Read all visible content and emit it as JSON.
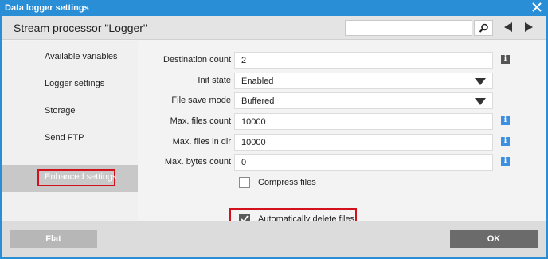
{
  "window": {
    "title": "Data logger settings"
  },
  "header": {
    "title": "Stream processor \"Logger\"",
    "search_value": ""
  },
  "sidebar": {
    "items": [
      {
        "label": "Available variables"
      },
      {
        "label": "Logger settings"
      },
      {
        "label": "Storage"
      },
      {
        "label": "Send FTP"
      },
      {
        "label": "Enhanced settings",
        "active": true
      }
    ]
  },
  "form": {
    "destination_count": {
      "label": "Destination count",
      "value": "2"
    },
    "init_state": {
      "label": "Init state",
      "value": "Enabled"
    },
    "file_save_mode": {
      "label": "File save mode",
      "value": "Buffered"
    },
    "max_files_count": {
      "label": "Max. files count",
      "value": "10000"
    },
    "max_files_in_dir": {
      "label": "Max. files in dir",
      "value": "10000"
    },
    "max_bytes_count": {
      "label": "Max. bytes count",
      "value": "0"
    },
    "compress_files": {
      "label": "Compress files",
      "checked": false
    },
    "auto_delete": {
      "label": "Automatically delete files",
      "checked": true
    },
    "info_glyph": "i"
  },
  "footer": {
    "flat_label": "Flat",
    "ok_label": "OK"
  },
  "colors": {
    "titlebar": "#2a8ed6",
    "highlight": "#d1121c",
    "info_blue": "#3d8fe0"
  }
}
